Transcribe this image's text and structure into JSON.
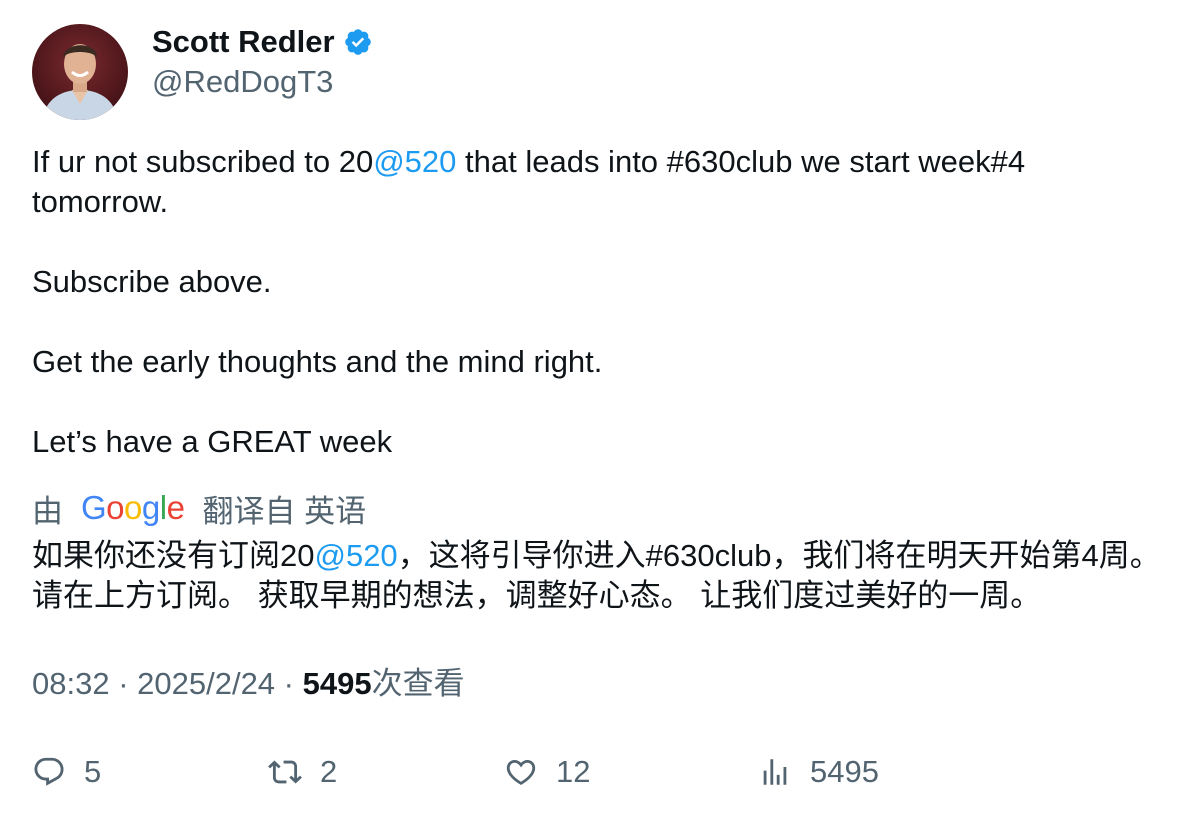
{
  "author": {
    "display_name": "Scott Redler",
    "handle": "@RedDogT3",
    "verified": true
  },
  "tweet": {
    "line1_pre": "If ur not subscribed to 20",
    "line1_mention": "@520",
    "line1_post": " that leads into #630club we start week#4 tomorrow.",
    "para2": "Subscribe above.",
    "para3": "Get the early thoughts and the mind right.",
    "para4": "Let’s have a GREAT week"
  },
  "translation": {
    "by_label": "由",
    "provider": "Google",
    "translated_from_label": "翻译自 英语",
    "text_pre": "如果你还没有订阅20",
    "text_mention": "@520",
    "text_post": "，这将引导你进入#630club，我们将在明天开始第4周。 请在上方订阅。 获取早期的想法，调整好心态。 让我们度过美好的一周。"
  },
  "meta": {
    "time": "08:32",
    "separator": " · ",
    "date": "2025/2/24",
    "views_count": "5495",
    "views_label": "次查看"
  },
  "actions": {
    "reply_count": "5",
    "retweet_count": "2",
    "like_count": "12",
    "views_count": "5495"
  },
  "colors": {
    "accent": "#1d9bf0",
    "secondary_text": "#536471",
    "primary_text": "#0f1419",
    "google_blue": "#4285f4",
    "google_red": "#ea4335",
    "google_yellow": "#fbbc05",
    "google_green": "#34a853"
  },
  "icons": {
    "avatar": "avatar-photo",
    "verified": "verified-badge-icon",
    "reply": "reply-icon",
    "retweet": "retweet-icon",
    "like": "heart-icon",
    "views": "views-bar-chart-icon"
  }
}
